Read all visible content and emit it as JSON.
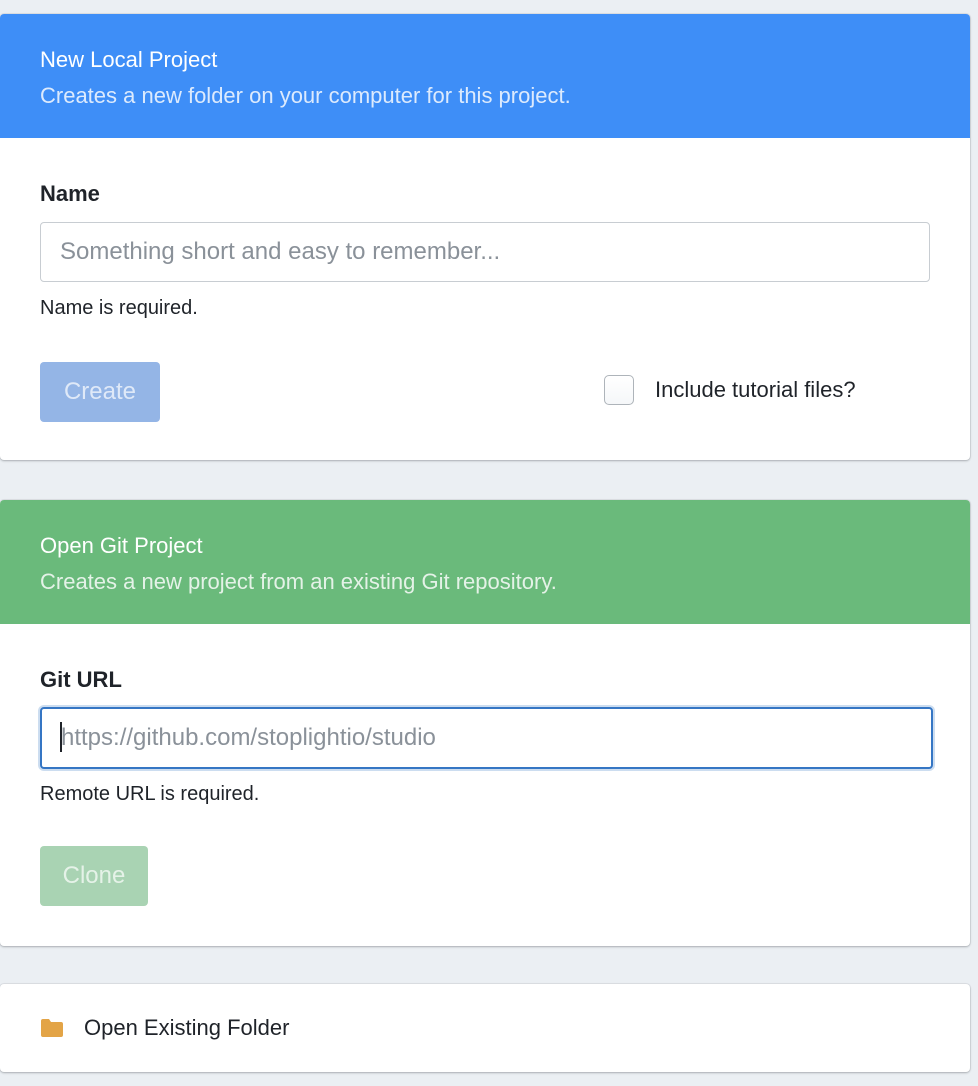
{
  "local_project": {
    "title": "New Local Project",
    "subtitle": "Creates a new folder on your computer for this project.",
    "header_color": "#3e8ef7",
    "name_label": "Name",
    "name_placeholder": "Something short and easy to remember...",
    "name_value": "",
    "name_helper": "Name is required.",
    "create_label": "Create",
    "create_color": "#94b5e6",
    "create_disabled": true,
    "tutorial_label": "Include tutorial files?",
    "tutorial_checked": false
  },
  "git_project": {
    "title": "Open Git Project",
    "subtitle": "Creates a new project from an existing Git repository.",
    "header_color": "#6aba7b",
    "url_label": "Git URL",
    "url_placeholder": "https://github.com/stoplightio/studio",
    "url_value": "",
    "url_helper": "Remote URL is required.",
    "clone_label": "Clone",
    "clone_color": "#a9d3b3",
    "clone_disabled": true
  },
  "open_folder": {
    "label": "Open Existing Folder",
    "icon": "folder-icon",
    "icon_color": "#e3a446"
  }
}
